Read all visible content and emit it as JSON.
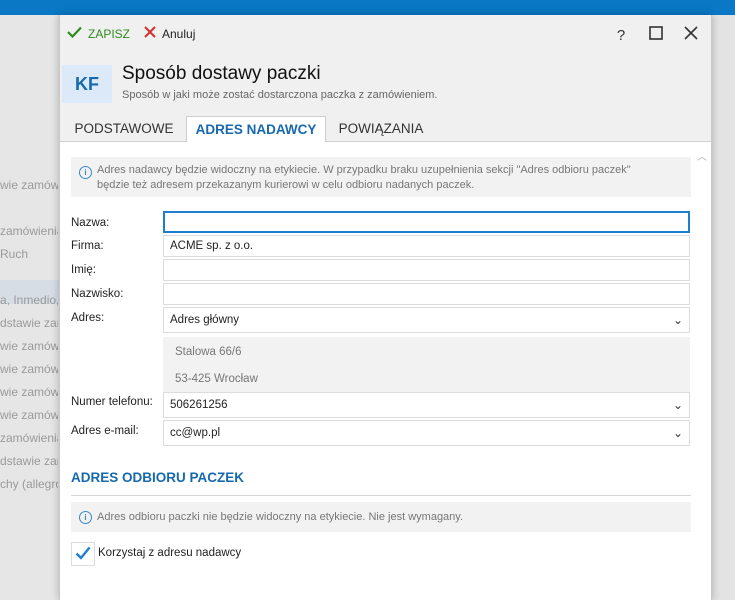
{
  "background": {
    "items": [
      "wie zamów",
      "zamówienia,",
      "Ruch",
      "a, Inmedio,",
      "dstawie zar",
      "wie zamów",
      "wie zamów",
      "wie zamów",
      "wie zamów",
      "zamówienia,",
      "dstawie zar",
      "chy (allegro"
    ]
  },
  "toolbar": {
    "save_label": "ZAPISZ",
    "cancel_label": "Anuluj",
    "help_label": "?"
  },
  "header": {
    "badge": "KF",
    "title": "Sposób dostawy paczki",
    "subtitle": "Sposób w jaki może zostać dostarczona paczka z zamówieniem."
  },
  "tabs": [
    {
      "label": "PODSTAWOWE",
      "active": false
    },
    {
      "label": "ADRES NADAWCY",
      "active": true
    },
    {
      "label": "POWIĄZANIA",
      "active": false
    }
  ],
  "sender_info": {
    "line1": "Adres nadawcy będzie widoczny na etykiecie. W przypadku braku uzupełnienia sekcji \"Adres odbioru paczek\"",
    "line2": "będzie też adresem przekazanym kurierowi w celu odbioru nadanych paczek."
  },
  "form": {
    "name_label": "Nazwa:",
    "name_value": "",
    "company_label": "Firma:",
    "company_value": "ACME sp. z o.o.",
    "firstname_label": "Imię:",
    "firstname_value": "",
    "lastname_label": "Nazwisko:",
    "lastname_value": "",
    "address_label": "Adres:",
    "address_value": "Adres główny",
    "address_line1": "Stalowa 66/6",
    "address_line2": "53-425 Wrocław",
    "phone_label": "Numer telefonu:",
    "phone_value": "506261256",
    "email_label": "Adres e-mail:",
    "email_value": "cc@wp.pl"
  },
  "pickup": {
    "title": "ADRES ODBIORU PACZEK",
    "info": "Adres odbioru paczki nie będzie widoczny na etykiecie. Nie jest wymagany.",
    "checkbox_label": "Korzystaj z adresu nadawcy",
    "checkbox_checked": true
  },
  "colors": {
    "accent": "#1769ae",
    "topbar": "#0a78c5",
    "save": "#2e8b1f",
    "cancel": "#d32f2f"
  }
}
